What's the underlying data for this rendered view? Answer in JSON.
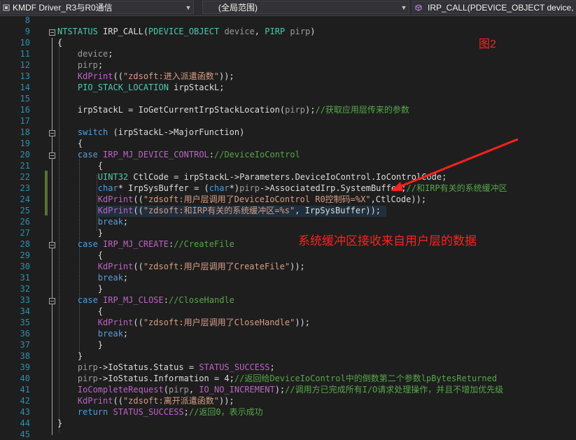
{
  "toolbar": {
    "project": "KMDF Driver_R3与R0通信",
    "scope": "(全局范围)",
    "function": "IRP_CALL(PDEVICE_OBJECT device, PIRP pirp)"
  },
  "annotations": {
    "figure_label": "图2",
    "note": "系统缓冲区接收来自用户层的数据"
  },
  "colors": {
    "accent_red": "#ff2020",
    "change_bar": "#577430"
  },
  "lines": [
    {
      "n": "8",
      "segs": []
    },
    {
      "n": "9",
      "segs": [
        {
          "c": "ty",
          "t": "NTSTATUS"
        },
        {
          "t": " IRP_CALL("
        },
        {
          "c": "ty",
          "t": "PDEVICE_OBJECT"
        },
        {
          "t": " "
        },
        {
          "c": "pr",
          "t": "device"
        },
        {
          "t": ", "
        },
        {
          "c": "ty",
          "t": "PIRP"
        },
        {
          "t": " "
        },
        {
          "c": "pr",
          "t": "pirp"
        },
        {
          "t": ")"
        }
      ]
    },
    {
      "n": "10",
      "segs": [
        {
          "t": "{"
        }
      ]
    },
    {
      "n": "11",
      "segs": [
        {
          "t": "    "
        },
        {
          "c": "pr",
          "t": "device"
        },
        {
          "t": ";"
        }
      ]
    },
    {
      "n": "12",
      "segs": [
        {
          "t": "    "
        },
        {
          "c": "pr",
          "t": "pirp"
        },
        {
          "t": ";"
        }
      ]
    },
    {
      "n": "13",
      "segs": [
        {
          "t": "    "
        },
        {
          "c": "mac",
          "t": "KdPrint"
        },
        {
          "t": "(("
        },
        {
          "c": "str",
          "t": "\"zdsoft:进入派遣函数\""
        },
        {
          "t": "));"
        }
      ]
    },
    {
      "n": "14",
      "segs": [
        {
          "t": "    "
        },
        {
          "c": "ty",
          "t": "PIO_STACK_LOCATION"
        },
        {
          "t": " irpStackL;"
        }
      ]
    },
    {
      "n": "15",
      "segs": []
    },
    {
      "n": "16",
      "segs": [
        {
          "t": "    irpStackL = IoGetCurrentIrpStackLocation("
        },
        {
          "c": "pr",
          "t": "pirp"
        },
        {
          "t": ");"
        },
        {
          "c": "cm",
          "t": "//获取应用层传来的参数"
        }
      ]
    },
    {
      "n": "17",
      "segs": []
    },
    {
      "n": "18",
      "segs": [
        {
          "t": "    "
        },
        {
          "c": "kw",
          "t": "switch"
        },
        {
          "t": " (irpStackL->MajorFunction)"
        }
      ]
    },
    {
      "n": "19",
      "segs": [
        {
          "t": "    {"
        }
      ]
    },
    {
      "n": "20",
      "segs": [
        {
          "t": "    "
        },
        {
          "c": "kw",
          "t": "case"
        },
        {
          "t": " "
        },
        {
          "c": "mac",
          "t": "IRP_MJ_DEVICE_CONTROL"
        },
        {
          "t": ":"
        },
        {
          "c": "cm",
          "t": "//DeviceIoControl"
        }
      ]
    },
    {
      "n": "21",
      "segs": [
        {
          "t": "        {"
        }
      ]
    },
    {
      "n": "22",
      "segs": [
        {
          "t": "        "
        },
        {
          "c": "ty",
          "t": "UINT32"
        },
        {
          "t": " CtlCode = irpStackL->Parameters.DeviceIoControl.IoControlCode;"
        }
      ]
    },
    {
      "n": "23",
      "segs": [
        {
          "t": "        "
        },
        {
          "c": "kw",
          "t": "char"
        },
        {
          "t": "* IrpSysBuffer = ("
        },
        {
          "c": "kw",
          "t": "char"
        },
        {
          "t": "*)"
        },
        {
          "c": "pr",
          "t": "pirp"
        },
        {
          "t": "->AssociatedIrp.SystemBuffer;"
        },
        {
          "c": "cm",
          "t": "//和IRP有关的系统缓冲区"
        }
      ]
    },
    {
      "n": "24",
      "segs": [
        {
          "t": "        "
        },
        {
          "c": "mac",
          "t": "KdPrint"
        },
        {
          "t": "(("
        },
        {
          "c": "str",
          "t": "\"zdsoft:用户层调用了DeviceIoControl R0控制码=%X\""
        },
        {
          "t": ",CtlCode));"
        }
      ]
    },
    {
      "n": "25",
      "segs": [
        {
          "t": "        "
        },
        {
          "c": "mac",
          "t": "KdPrint"
        },
        {
          "t": "(("
        },
        {
          "c": "str",
          "t": "\"zdsoft:和IRP有关的系统缓冲区=%s\""
        },
        {
          "t": ", IrpSysBuffer));"
        }
      ]
    },
    {
      "n": "26",
      "segs": [
        {
          "t": "        "
        },
        {
          "c": "kw",
          "t": "break"
        },
        {
          "t": ";"
        }
      ]
    },
    {
      "n": "27",
      "segs": [
        {
          "t": "        }"
        }
      ]
    },
    {
      "n": "28",
      "segs": [
        {
          "t": "    "
        },
        {
          "c": "kw",
          "t": "case"
        },
        {
          "t": " "
        },
        {
          "c": "mac",
          "t": "IRP_MJ_CREATE"
        },
        {
          "t": ":"
        },
        {
          "c": "cm",
          "t": "//CreateFile"
        }
      ]
    },
    {
      "n": "29",
      "segs": [
        {
          "t": "        {"
        }
      ]
    },
    {
      "n": "30",
      "segs": [
        {
          "t": "        "
        },
        {
          "c": "mac",
          "t": "KdPrint"
        },
        {
          "t": "(("
        },
        {
          "c": "str",
          "t": "\"zdsoft:用户层调用了CreateFile\""
        },
        {
          "t": "));"
        }
      ]
    },
    {
      "n": "31",
      "segs": [
        {
          "t": "        "
        },
        {
          "c": "kw",
          "t": "break"
        },
        {
          "t": ";"
        }
      ]
    },
    {
      "n": "32",
      "segs": [
        {
          "t": "        }"
        }
      ]
    },
    {
      "n": "33",
      "segs": [
        {
          "t": "    "
        },
        {
          "c": "kw",
          "t": "case"
        },
        {
          "t": " "
        },
        {
          "c": "mac",
          "t": "IRP_MJ_CLOSE"
        },
        {
          "t": ":"
        },
        {
          "c": "cm",
          "t": "//CloseHandle"
        }
      ]
    },
    {
      "n": "34",
      "segs": [
        {
          "t": "        {"
        }
      ]
    },
    {
      "n": "35",
      "segs": [
        {
          "t": "        "
        },
        {
          "c": "mac",
          "t": "KdPrint"
        },
        {
          "t": "(("
        },
        {
          "c": "str",
          "t": "\"zdsoft:用户层调用了CloseHandle\""
        },
        {
          "t": "));"
        }
      ]
    },
    {
      "n": "36",
      "segs": [
        {
          "t": "        "
        },
        {
          "c": "kw",
          "t": "break"
        },
        {
          "t": ";"
        }
      ]
    },
    {
      "n": "37",
      "segs": [
        {
          "t": "        }"
        }
      ]
    },
    {
      "n": "38",
      "segs": [
        {
          "t": "    }"
        }
      ]
    },
    {
      "n": "39",
      "segs": [
        {
          "t": "    "
        },
        {
          "c": "pr",
          "t": "pirp"
        },
        {
          "t": "->IoStatus.Status = "
        },
        {
          "c": "mac",
          "t": "STATUS_SUCCESS"
        },
        {
          "t": ";"
        }
      ]
    },
    {
      "n": "40",
      "segs": [
        {
          "t": "    "
        },
        {
          "c": "pr",
          "t": "pirp"
        },
        {
          "t": "->IoStatus.Information = 4;"
        },
        {
          "c": "cm",
          "t": "//返回给DeviceIoControl中的倒数第二个参数lpBytesReturned"
        }
      ]
    },
    {
      "n": "41",
      "segs": [
        {
          "t": "    "
        },
        {
          "c": "mac",
          "t": "IoCompleteRequest"
        },
        {
          "t": "("
        },
        {
          "c": "pr",
          "t": "pirp"
        },
        {
          "t": ", "
        },
        {
          "c": "mac",
          "t": "IO_NO_INCREMENT"
        },
        {
          "t": ");"
        },
        {
          "c": "cm",
          "t": "//调用方已完成所有I/O请求处理操作，并且不增加优先级"
        }
      ]
    },
    {
      "n": "42",
      "segs": [
        {
          "t": "    "
        },
        {
          "c": "mac",
          "t": "KdPrint"
        },
        {
          "t": "(("
        },
        {
          "c": "str",
          "t": "\"zdsoft:离开派遣函数\""
        },
        {
          "t": "));"
        }
      ]
    },
    {
      "n": "43",
      "segs": [
        {
          "t": "    "
        },
        {
          "c": "kw",
          "t": "return"
        },
        {
          "t": " "
        },
        {
          "c": "mac",
          "t": "STATUS_SUCCESS"
        },
        {
          "t": ";"
        },
        {
          "c": "cm",
          "t": "//返回0，表示成功"
        }
      ]
    },
    {
      "n": "44",
      "segs": [
        {
          "t": "}"
        }
      ]
    },
    {
      "n": "45",
      "segs": []
    }
  ]
}
